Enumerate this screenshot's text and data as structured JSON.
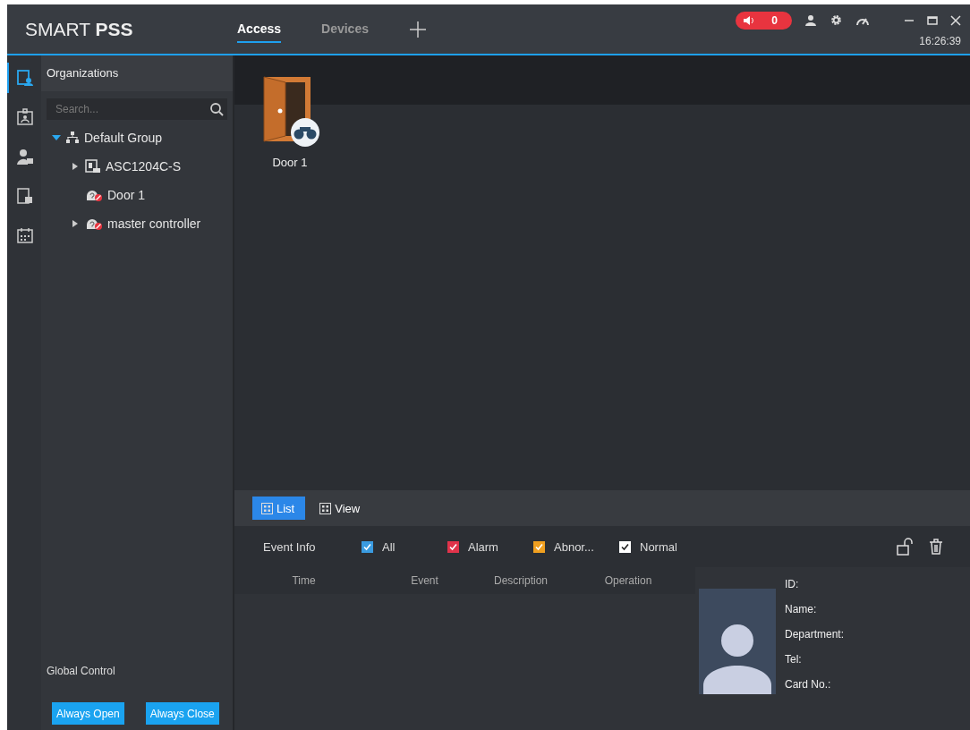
{
  "header": {
    "logo": "SMART **PSS**",
    "tabs": [
      {
        "label": "Access",
        "selected": true
      },
      {
        "label": "Devices",
        "selected": false
      }
    ],
    "alarm_count": "0",
    "time": "16:26:39"
  },
  "rail": [
    {
      "kind": "org",
      "selected": true
    },
    {
      "kind": "badge",
      "selected": false
    },
    {
      "kind": "person-lock",
      "selected": false
    },
    {
      "kind": "door-lock",
      "selected": false
    },
    {
      "kind": "calendar",
      "selected": false
    }
  ],
  "left_panel": {
    "title": "Organizations",
    "search": {
      "placeholder": "Search..."
    },
    "tree": [
      {
        "label": "Default Group",
        "kind": "group",
        "expanded": true,
        "children": [
          {
            "label": "ASC1204C-S",
            "kind": "device",
            "expanded": false
          },
          {
            "label": "Door 1",
            "kind": "door"
          },
          {
            "label": "master controller",
            "kind": "door",
            "expanded": false
          }
        ]
      }
    ],
    "global_control": {
      "title": "Global Control",
      "buttons": [
        "Always Open",
        "Always Close"
      ]
    }
  },
  "doors": [
    {
      "label": "Door 1"
    }
  ],
  "view_tabs": [
    {
      "label": "List",
      "selected": true
    },
    {
      "label": "View",
      "selected": false
    }
  ],
  "event_filter": {
    "label": "Event Info",
    "options": [
      {
        "label": "All",
        "checked": true,
        "color": "#3a9be0"
      },
      {
        "label": "Alarm",
        "checked": true,
        "color": "#e0334a"
      },
      {
        "label": "Abnor...",
        "checked": true,
        "color": "#f0a020"
      },
      {
        "label": "Normal",
        "checked": true,
        "color": "#ffffff"
      }
    ]
  },
  "table": {
    "columns": [
      "Time",
      "Event",
      "Description",
      "Operation"
    ]
  },
  "person_card": {
    "fields": [
      "ID:",
      "Name:",
      "Department:",
      "Tel:",
      "Card No.:"
    ]
  }
}
